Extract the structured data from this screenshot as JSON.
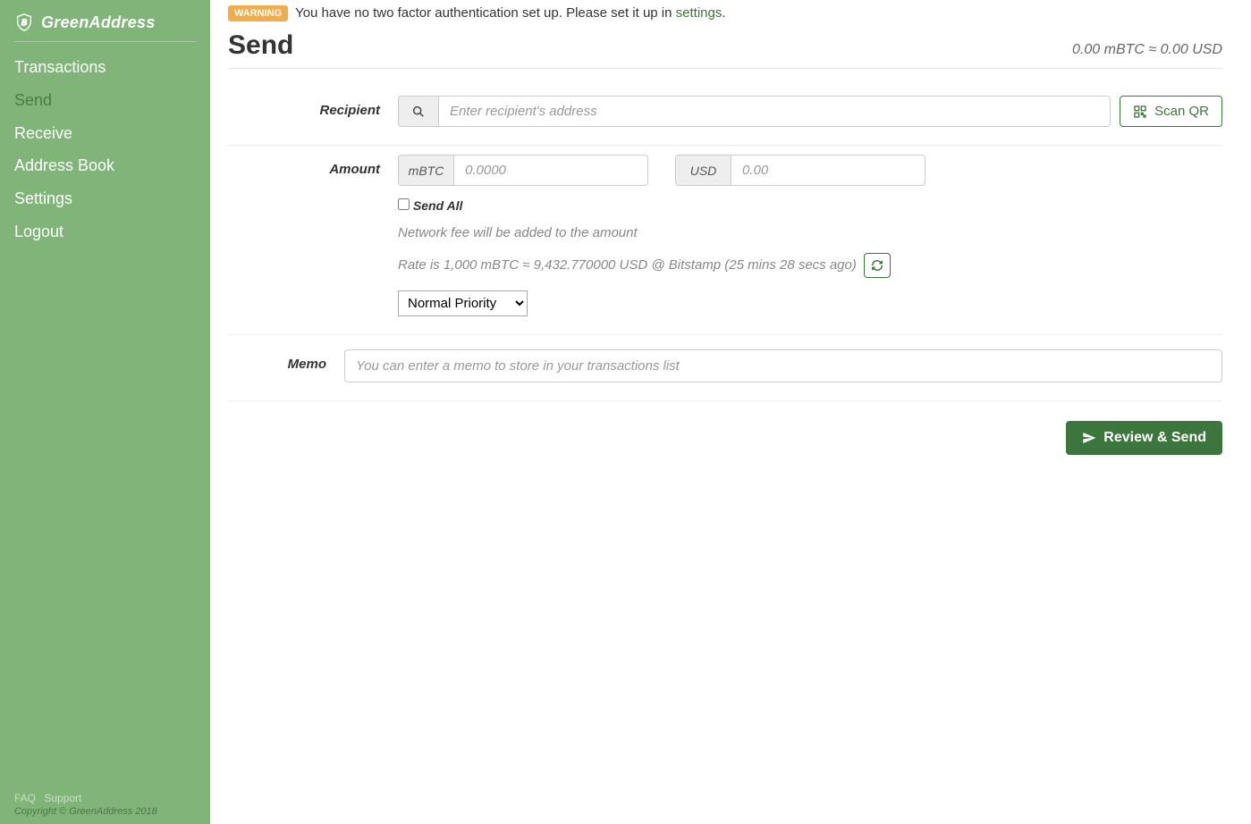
{
  "brand": "GreenAddress",
  "nav": {
    "items": [
      "Transactions",
      "Send",
      "Receive",
      "Address Book",
      "Settings",
      "Logout"
    ],
    "active_index": 1
  },
  "footer": {
    "faq": "FAQ",
    "support": "Support",
    "copyright": "Copyright © GreenAddress 2018"
  },
  "warning": {
    "badge": "WARNING",
    "text_before": "You have no two factor authentication set up. Please set it up in ",
    "link": "settings",
    "text_after": "."
  },
  "page_title": "Send",
  "balance": "0.00 mBTC ≈ 0.00 USD",
  "recipient": {
    "label": "Recipient",
    "placeholder": "Enter recipient's address",
    "scan_label": "Scan QR"
  },
  "amount": {
    "label": "Amount",
    "unit_crypto": "mBTC",
    "placeholder_crypto": "0.0000",
    "unit_fiat": "USD",
    "placeholder_fiat": "0.00",
    "send_all_label": "Send All",
    "fee_note": "Network fee will be added to the amount",
    "rate_note": "Rate is 1,000 mBTC ≈ 9,432.770000 USD @ Bitstamp (25 mins 28 secs ago)",
    "priority_options": [
      "Normal Priority"
    ],
    "priority_selected": "Normal Priority"
  },
  "memo": {
    "label": "Memo",
    "placeholder": "You can enter a memo to store in your transactions list"
  },
  "actions": {
    "review_send": "Review & Send"
  }
}
